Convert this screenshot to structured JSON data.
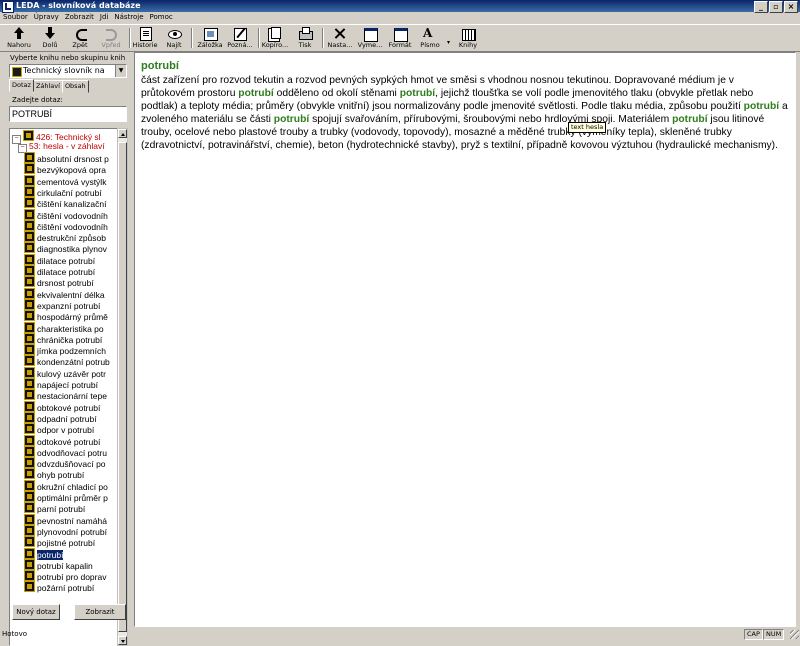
{
  "window": {
    "title": "LEDA - slovníková databáze",
    "minimize": "_",
    "maximize": "▫",
    "close": "×"
  },
  "menu": [
    "Soubor",
    "Úpravy",
    "Zobrazit",
    "Jdi",
    "Nástroje",
    "Pomoc"
  ],
  "toolbar": {
    "back": "Nahoru",
    "down": "Dolů",
    "undo": "Zpět",
    "forward": "Vpřed",
    "history": "Historie",
    "find": "Najít",
    "bookmark": "Záložka",
    "note": "Pozná...",
    "copy": "Kopíro...",
    "print": "Tisk",
    "settings": "Nasta...",
    "view": "Vyme...",
    "format": "Formát",
    "font": "Písmo",
    "books": "Knihy",
    "font_glyph": "A",
    "dropdown_glyph": "▾"
  },
  "left": {
    "select_label": "Vyberte knihu nebo skupinu knih",
    "book_selected": "Technický slovník na",
    "combo_arrow": "▼",
    "tabs": [
      "Dotaz",
      "Záhlaví",
      "Obsah"
    ],
    "query_label": "Zadejte dotaz:",
    "query_value": "POTRUBÍ",
    "tree_root": {
      "expander": "−",
      "label": "426: Technický sl"
    },
    "tree_group": {
      "expander": "−",
      "label": "53: hesla - v záhlaví"
    },
    "tree_items": [
      "absolutní drsnost p",
      "bezvýkopová opra",
      "cementová vystýlk",
      "cirkulační potrubí",
      "čištění kanalizační",
      "čištění vodovodníh",
      "čištění vodovodníh",
      "destrukční způsob",
      "diagnostika plynov",
      "dilatace potrubí",
      "dilatace potrubí",
      "drsnost potrubí",
      "ekvivalentní délka",
      "expanzní potrubí",
      "hospodárný průmě",
      "charakteristika po",
      "chránička potrubí",
      "jímka podzemních",
      "kondenzátní potrub",
      "kulový uzávěr potr",
      "napájecí potrubí",
      "nestacionární tepe",
      "obtokové potrubí",
      "odpadní potrubí",
      "odpor v potrubí",
      "odtokové potrubí",
      "odvodňovací potru",
      "odvzdušňovací po",
      "ohyb potrubí",
      "okružní chladicí po",
      "optimální průměr p",
      "parní potrubí",
      "pevnostní namáhá",
      "plynovodní potrubí",
      "pojistné potrubí",
      "potrubí",
      "potrubí kapalin",
      "potrubí pro doprav",
      "požární potrubí"
    ],
    "selected_index": 35,
    "new_query_btn": "Nový dotaz",
    "show_btn": "Zobrazit"
  },
  "content": {
    "headword": "potrubí",
    "paragraphs": [
      [
        "část zařízení pro rozvod tekutin a rozvod pevných sypkých hmot ve směsi s vhodnou nosnou tekutinou. Dopravované médium je v průtokovém prostoru ",
        {
          "b": "potrubí"
        },
        " odděleno od okolí stěnami ",
        {
          "b": "potrubí"
        },
        ", jejichž tloušťka se volí podle jmenovitého tlaku (obvykle přetlak nebo podtlak) a teploty média; průměry (obvykle vnitřní) jsou normalizovány podle jmenovité světlosti. Podle tlaku média, způsobu použití ",
        {
          "b": "potrubí"
        },
        " a zvoleného materiálu se části ",
        {
          "b": "potrubí"
        },
        " spojují svařováním, přírubovými, šroubovými nebo hrdlovými spoji. Materiálem ",
        {
          "b": "potrubí"
        },
        " jsou litinové trouby, ocelové nebo plastové trouby a trubky (vodovody, topovody), mosazné a měděné trubky (výměníky tepla), skleněné trubky (zdravotnictví, potravinářství, chemie), beton (hydrotechnické stavby), pryž s textilní, případně kovovou výztuhou (hydraulické mechanismy)."
      ]
    ],
    "tooltip": "text hesla"
  },
  "status": {
    "text": "Hotovo",
    "cap": "CAP",
    "num": "NUM"
  }
}
